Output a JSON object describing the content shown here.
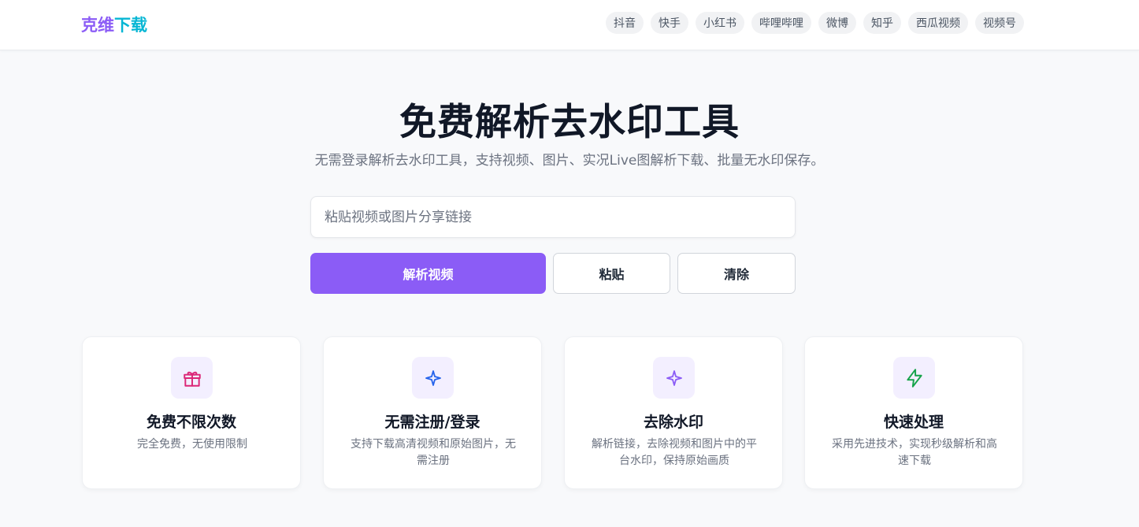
{
  "header": {
    "logo_part1": "克维",
    "logo_part2": "下载",
    "nav": [
      "抖音",
      "快手",
      "小红书",
      "哔哩哔哩",
      "微博",
      "知乎",
      "西瓜视频",
      "视频号"
    ]
  },
  "hero": {
    "title": "免费解析去水印工具",
    "subtitle": "无需登录解析去水印工具，支持视频、图片、实况Live图解析下载、批量无水印保存。"
  },
  "search": {
    "placeholder": "粘贴视频或图片分享链接",
    "value": ""
  },
  "actions": {
    "parse_label": "解析视频",
    "paste_label": "粘贴",
    "clear_label": "清除"
  },
  "features": [
    {
      "icon": "gift-icon",
      "title": "免费不限次数",
      "desc": "完全免费，无使用限制"
    },
    {
      "icon": "sparkle-icon",
      "title": "无需注册/登录",
      "desc": "支持下载高清视频和原始图片，无需注册"
    },
    {
      "icon": "sparkle-icon",
      "title": "去除水印",
      "desc": "解析链接，去除视频和图片中的平台水印，保持原始画质"
    },
    {
      "icon": "lightning-icon",
      "title": "快速处理",
      "desc": "采用先进技术，实现秒级解析和高速下载"
    }
  ],
  "colors": {
    "brand_purple": "#8b5cf6",
    "brand_cyan": "#06b6d4",
    "gift_icon": "#db2777",
    "sparkle_blue": "#2563eb",
    "sparkle_purple": "#8b5cf6",
    "lightning_green": "#16a34a"
  }
}
